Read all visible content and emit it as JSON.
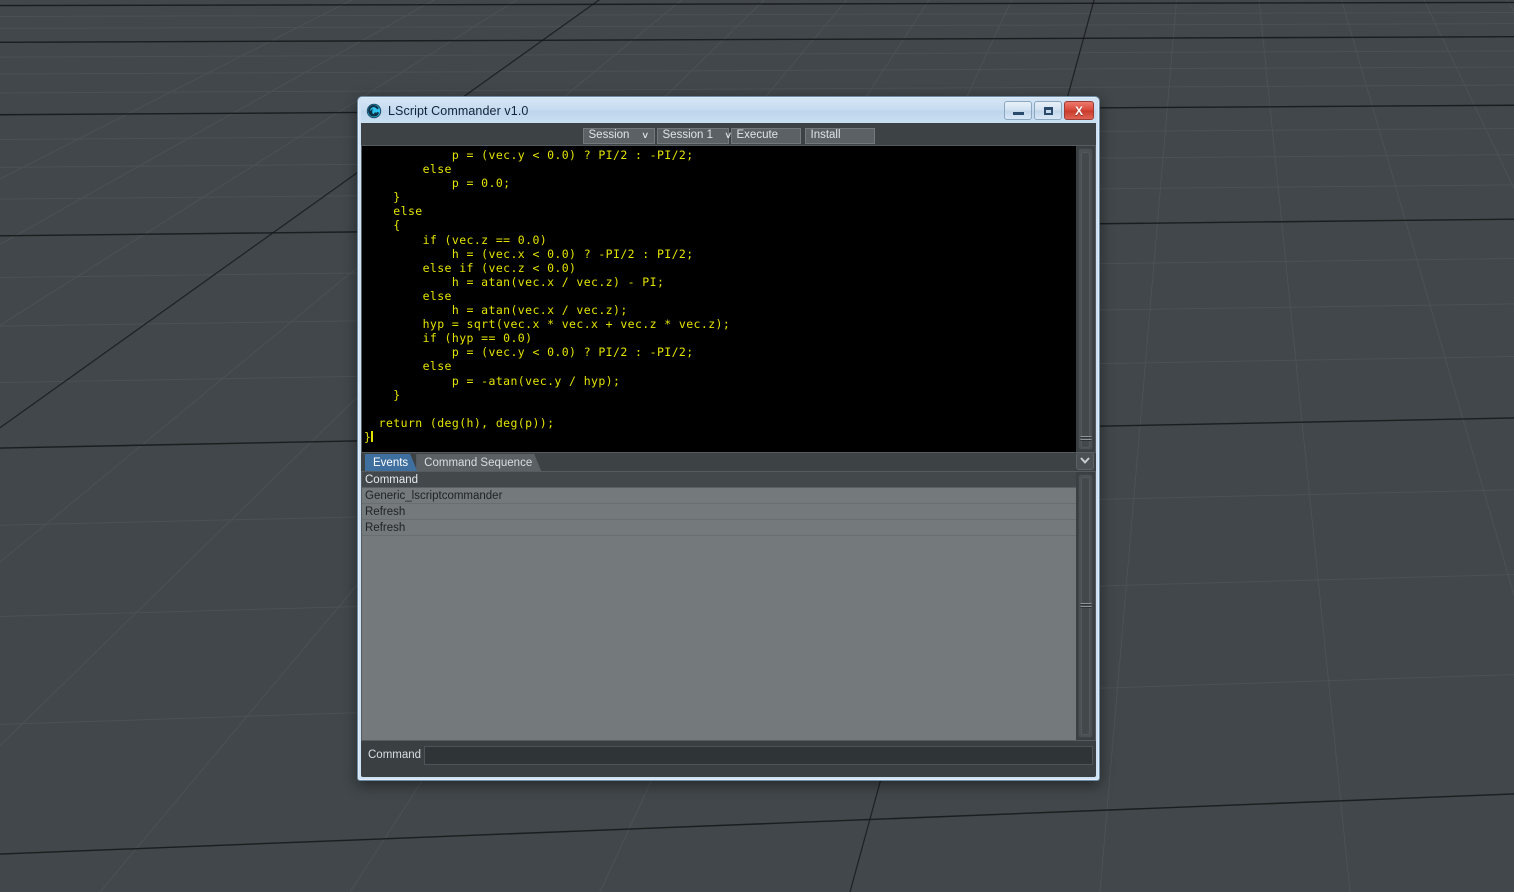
{
  "window": {
    "title": "LScript Commander v1.0",
    "icon": "lightwave-spiral-icon",
    "buttons": {
      "minimize": "minimize-icon",
      "maximize": "maximize-icon",
      "close": "X"
    }
  },
  "toolbar": {
    "session_select": "Session",
    "session_number_select": "Session 1",
    "execute_label": "Execute",
    "install_label": "Install",
    "caret": "∨"
  },
  "editor": {
    "code": "            p = (vec.y < 0.0) ? PI/2 : -PI/2;\n        else\n            p = 0.0;\n    }\n    else\n    {\n        if (vec.z == 0.0)\n            h = (vec.x < 0.0) ? -PI/2 : PI/2;\n        else if (vec.z < 0.0)\n            h = atan(vec.x / vec.z) - PI;\n        else\n            h = atan(vec.x / vec.z);\n        hyp = sqrt(vec.x * vec.x + vec.z * vec.z);\n        if (hyp == 0.0)\n            p = (vec.y < 0.0) ? PI/2 : -PI/2;\n        else\n            p = -atan(vec.y / hyp);\n    }\n\n  return (deg(h), deg(p));",
    "last_line": "}",
    "text_color": "#e3e300",
    "background": "#000000"
  },
  "tabs": [
    {
      "label": "Events",
      "active": true
    },
    {
      "label": "Command Sequence",
      "active": false
    }
  ],
  "tab_scroll_icon": "chevron-down-icon",
  "list": {
    "column_header": "Command",
    "rows": [
      "Generic_lscriptcommander",
      "Refresh",
      "Refresh"
    ]
  },
  "command_bar": {
    "label": "Command",
    "value": "",
    "placeholder": ""
  },
  "colors": {
    "accent": "#3e6f9e",
    "titlebar": "#c7dcf0",
    "close_button": "#d9483a",
    "panel": "#3a3f42",
    "list_background": "#74797c",
    "viewport": "#41474a"
  }
}
